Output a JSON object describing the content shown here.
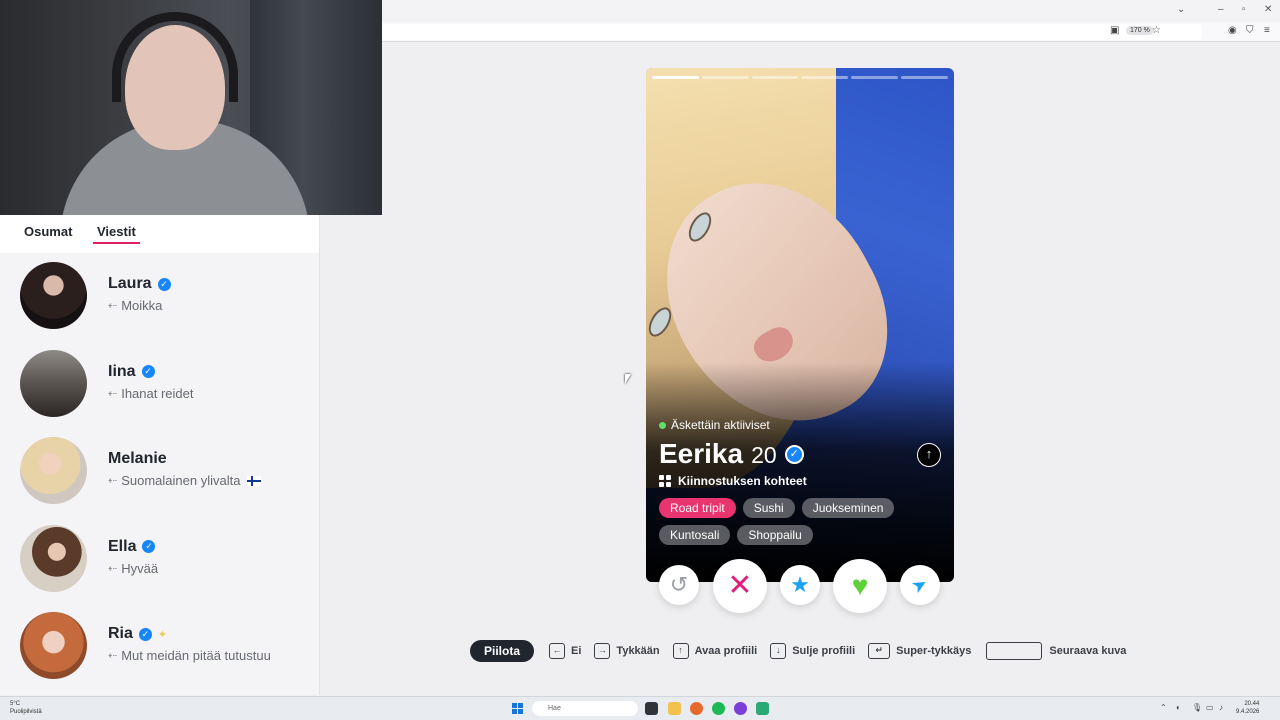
{
  "browser": {
    "zoom": "170 %"
  },
  "tabs": [
    {
      "label": "Osumat",
      "active": false
    },
    {
      "label": "Viestit",
      "active": true
    }
  ],
  "matches": [
    {
      "name": "Laura",
      "verified": true,
      "message": "Moikka"
    },
    {
      "name": "Iina",
      "verified": true,
      "message": "Ihanat reidet"
    },
    {
      "name": "Melanie",
      "verified": false,
      "message": "Suomalainen ylivalta"
    },
    {
      "name": "Ella",
      "verified": true,
      "message": "Hyvää"
    },
    {
      "name": "Ria",
      "verified": true,
      "message": "Mut meidän pitää tutustuu"
    }
  ],
  "profile": {
    "status": "Äskettäin aktiiviset",
    "name": "Eerika",
    "age": "20",
    "interests_heading": "Kiinnostuksen kohteet",
    "interests": [
      "Road tripit",
      "Sushi",
      "Juokseminen",
      "Kuntosali",
      "Shoppailu"
    ],
    "photo_count": 6,
    "current_photo": 1
  },
  "actions": {
    "rewind": "rewind-icon",
    "nope": "x-icon",
    "super_like": "star-icon",
    "like": "heart-icon",
    "boost": "send-icon"
  },
  "shortcuts": {
    "hide": "Piilota",
    "no": "Ei",
    "like": "Tykkään",
    "open_profile": "Avaa profiili",
    "close_profile": "Sulje profiili",
    "super_like": "Super-tykkäys",
    "next_photo": "Seuraava kuva"
  },
  "taskbar": {
    "weather_temp": "5°C",
    "weather_desc": "Puolipilvistä",
    "search_placeholder": "Hae",
    "time": "20.44",
    "date": "9.4.2026"
  },
  "colors": {
    "brand": "#e01f5e",
    "verified": "#1786f8",
    "highlight_chip": "#e9356f",
    "online": "#5fe068"
  }
}
